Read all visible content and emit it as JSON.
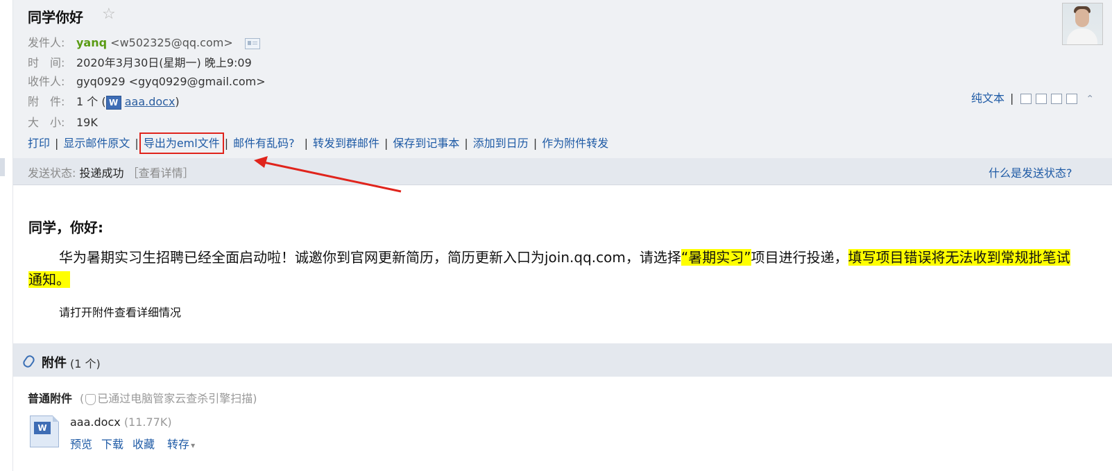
{
  "email": {
    "subject": "同学你好",
    "star_glyph": "☆",
    "labels": {
      "from": "发件人:",
      "time": "时　间:",
      "to": "收件人:",
      "attach": "附　件:",
      "size": "大　小:"
    },
    "from_name": "yanq",
    "from_addr": "<w502325@qq.com>",
    "time_value": "2020年3月30日(星期一) 晚上9:09",
    "to_value": "gyq0929 <gyq0929@gmail.com>",
    "attach_count": "1 个 (",
    "attach_icon_glyph": "W",
    "attach_name": "aaa.docx",
    "attach_close": ")",
    "size_value": "19K"
  },
  "toolbar": {
    "print": "打印",
    "show_source": "显示邮件原文",
    "export_eml": "导出为eml文件",
    "garbled": "邮件有乱码?",
    "forward_group": "转发到群邮件",
    "save_notes": "保存到记事本",
    "add_calendar": "添加到日历",
    "forward_attach": "作为附件转发",
    "separator": "|"
  },
  "right_tools": {
    "plain_text": "纯文本",
    "separator": "|",
    "collapse_glyph": "⌃"
  },
  "status": {
    "label": "发送状态:",
    "value": "投递成功",
    "detail": "［查看详情］",
    "help": "什么是发送状态?"
  },
  "body": {
    "greeting": "同学，你好:",
    "para_part1": "华为暑期实习生招聘已经全面启动啦！诚邀你到官网更新简历，简历更新入口为join.qq.com，请选择",
    "para_hl1": "“暑期实习”",
    "para_part2": "项目进行投递，",
    "para_hl2": "填写项目错误将无法收到常规批笔试通知。",
    "note": "请打开附件查看详细情况"
  },
  "attachments": {
    "title": "附件",
    "count": "(1 个)",
    "kind": "普通附件",
    "scan_open": "(",
    "scan_text": "已通过电脑管家云查杀引擎扫描)",
    "file_icon_glyph": "W",
    "file_name": "aaa.docx",
    "file_size": "(11.77K)",
    "actions": {
      "preview": "预览",
      "download": "下载",
      "favorite": "收藏",
      "save_to": "转存"
    },
    "caret_glyph": "▾"
  },
  "colors": {
    "header_bg": "#eff1f4",
    "status_bg": "#e4e8ee",
    "link": "#1e5aa5",
    "sender_green": "#5a9b14",
    "highlight": "#ffff00",
    "annotation_red": "#e0241c"
  },
  "icons": [
    "star-icon",
    "contact-card-icon",
    "word-doc-icon",
    "paperclip-icon",
    "shield-icon",
    "avatar",
    "new-window-icon",
    "print-icon",
    "collapse-icon"
  ]
}
